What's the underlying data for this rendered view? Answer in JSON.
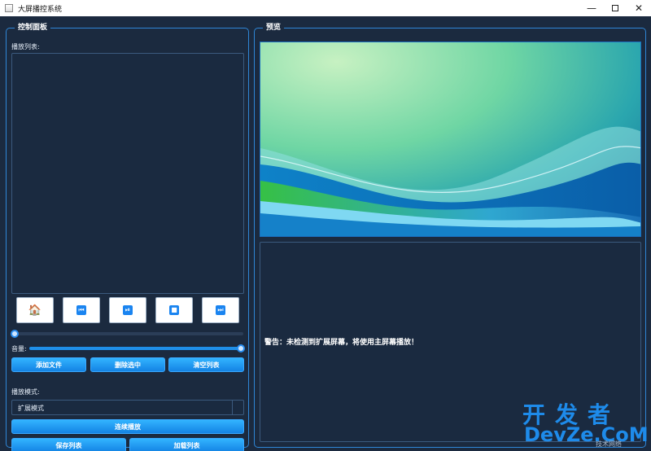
{
  "window": {
    "title": "大屏播控系统",
    "controls": {
      "minimize": "—",
      "close": "✕"
    }
  },
  "control_panel": {
    "title": "控制面板",
    "playlist_label": "播放列表:",
    "playlist_items": [],
    "transport": [
      {
        "name": "home-button",
        "icon": "home-icon",
        "glyph": "🏠"
      },
      {
        "name": "previous-button",
        "icon": "skip-previous-icon",
        "glyph": "⏮"
      },
      {
        "name": "play-pause-button",
        "icon": "play-pause-icon",
        "glyph": "⏯"
      },
      {
        "name": "stop-button",
        "icon": "stop-icon",
        "glyph": "■"
      },
      {
        "name": "next-button",
        "icon": "skip-next-icon",
        "glyph": "⏭"
      }
    ],
    "progress": 0.0,
    "volume_label": "音量:",
    "volume": 1.0,
    "buttons": {
      "add_file": "添加文件",
      "delete_selected": "删除选中",
      "clear_list": "清空列表"
    },
    "play_mode_label": "播放模式:",
    "play_mode_value": "扩展模式",
    "continuous_play": "连续播放",
    "save_list": "保存列表",
    "load_list": "加载列表"
  },
  "preview_panel": {
    "title": "预览",
    "warning_text": "警告：未检测到扩展屏幕，将使用主屏幕播放！"
  },
  "watermark": {
    "cn": "开发者",
    "en": "DevZe.CoM",
    "small": "技术网络"
  },
  "colors": {
    "background": "#1b2a3f",
    "accent": "#1f8fe8",
    "border": "#2f86d6"
  }
}
